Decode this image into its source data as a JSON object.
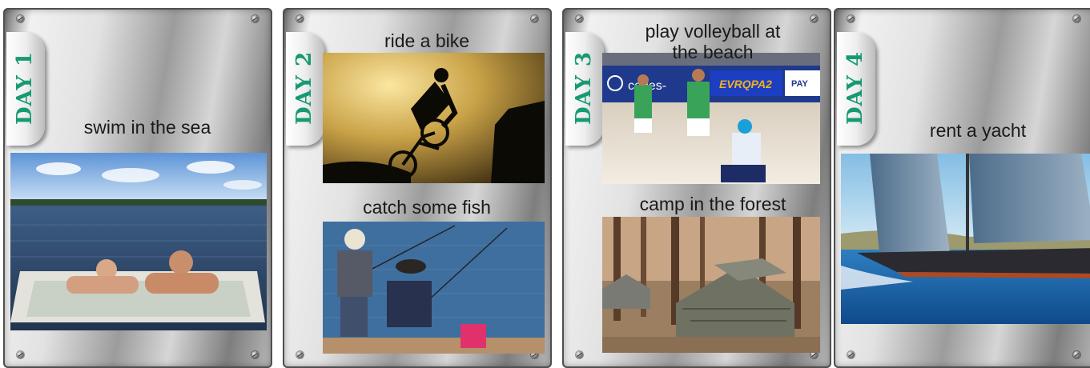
{
  "days": [
    {
      "day_label": "DAY 1",
      "activities": [
        "swim in the sea"
      ]
    },
    {
      "day_label": "DAY 2",
      "activities": [
        "ride a bike",
        "catch some fish"
      ]
    },
    {
      "day_label": "DAY 3",
      "activities": [
        "play volleyball at",
        "the beach",
        "camp in the forest"
      ]
    },
    {
      "day_label": "DAY 4",
      "activities": [
        "rent a yacht"
      ]
    }
  ],
  "banner_texts": [
    "cedes-",
    "EVRQPA2",
    "PAY"
  ],
  "colors": {
    "day_label": "#169a73",
    "text": "#1a1a1a"
  }
}
